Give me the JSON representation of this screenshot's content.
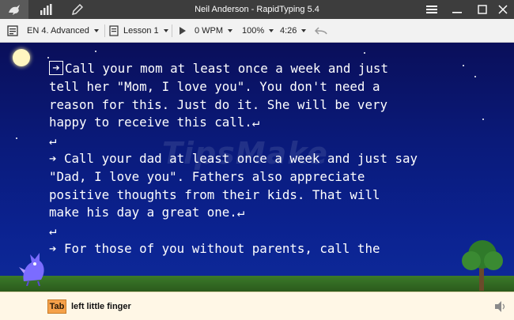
{
  "window": {
    "title": "Neil Anderson - RapidTyping 5.4"
  },
  "titlebar_tabs": [
    {
      "icon": "dragon-icon"
    },
    {
      "icon": "statistics-icon"
    },
    {
      "icon": "pencil-icon"
    }
  ],
  "toolbar": {
    "course": "EN 4. Advanced",
    "lesson": "Lesson 1",
    "wpm": "0 WPM",
    "zoom": "100%",
    "time": "4:26"
  },
  "lesson_text": {
    "lines": [
      "Call your mom at least once a week and just",
      "tell her \"Mom, I love you\". You don't need a",
      "reason for this. Just do it. She will be very",
      "happy to receive this call.↵",
      "↵",
      "➔ Call your dad at least once a week and just say",
      "\"Dad, I love you\". Fathers also appreciate",
      "positive thoughts from their kids. That will",
      "make his day a great one.↵",
      "↵",
      "➔ For those of you without parents, call the"
    ],
    "cursor_glyph": "➔"
  },
  "watermark": "TipsMake",
  "status": {
    "key": "Tab",
    "finger": "left little finger"
  }
}
